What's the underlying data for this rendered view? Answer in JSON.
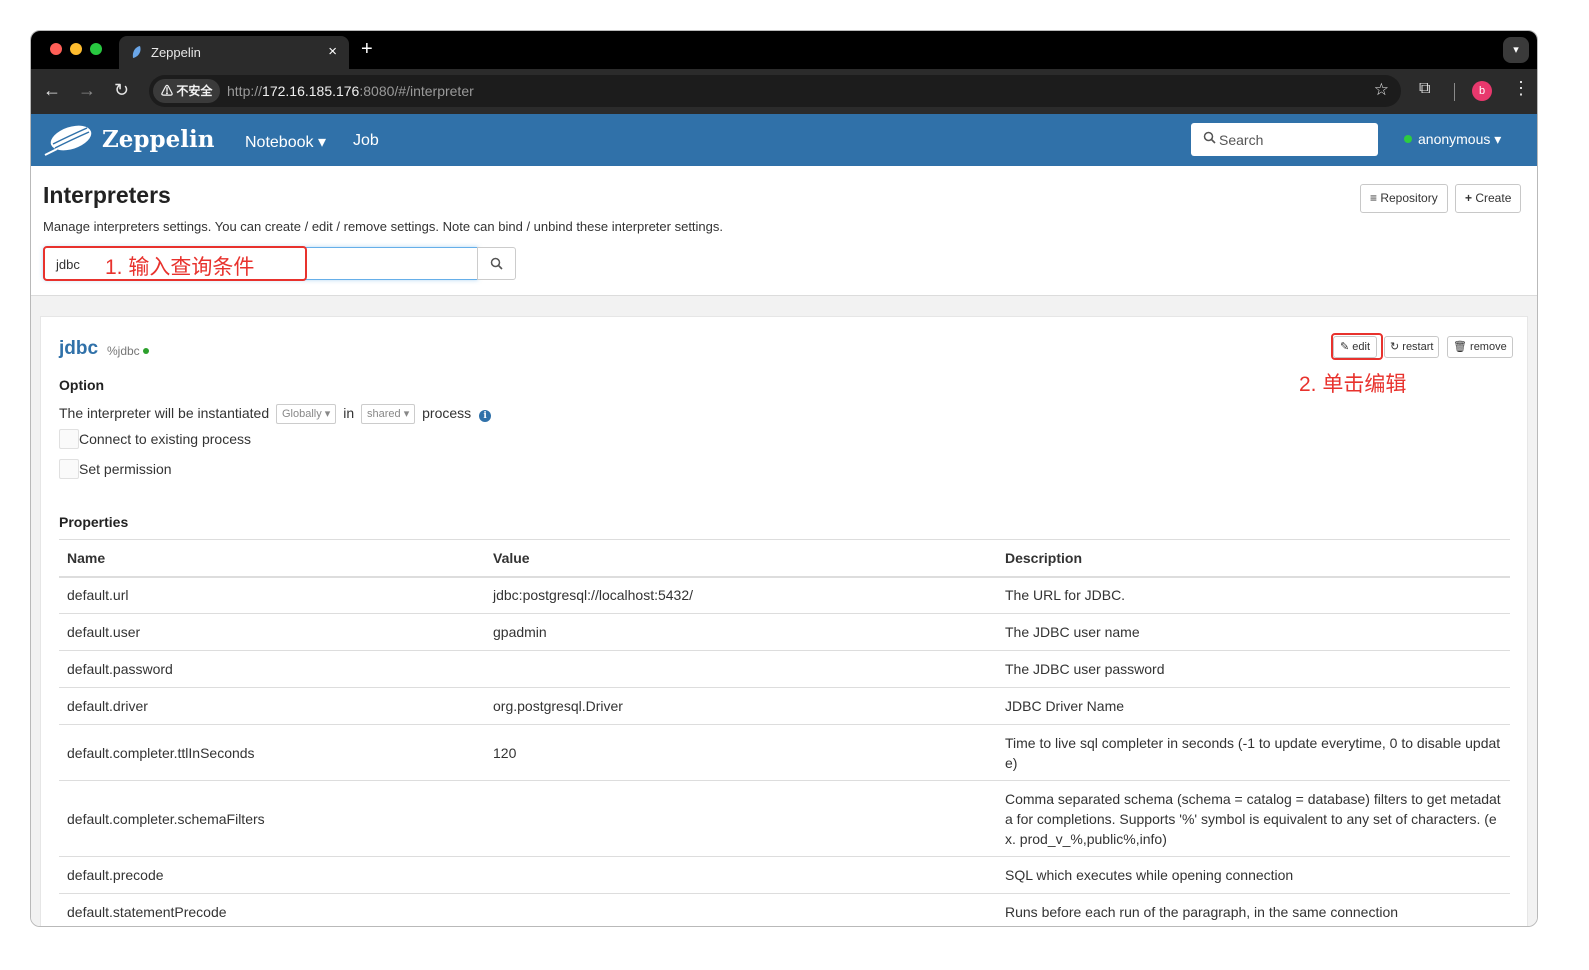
{
  "browser": {
    "tab_title": "Zeppelin",
    "tab_close": "×",
    "new_tab": "+",
    "security_label": "⚠ 不安全",
    "url_scheme": "http://",
    "url_host": "172.16.185.176",
    "url_rest": ":8080/#/interpreter",
    "profile_initial": "b"
  },
  "navbar": {
    "brand": "Zeppelin",
    "notebook_label": "Notebook ▾",
    "job_label": "Job",
    "search_placeholder": "Search",
    "user_label": "anonymous ▾"
  },
  "header": {
    "title": "Interpreters",
    "description": "Manage interpreters settings. You can create / edit / remove settings. Note can bind / unbind these interpreter settings.",
    "repository_label": "Repository",
    "create_label": "Create",
    "filter_value": "jdbc"
  },
  "annotations": {
    "step1": "1. 输入查询条件",
    "step2": "2. 单击编辑"
  },
  "interpreter": {
    "name": "jdbc",
    "alias": "%jdbc",
    "status_color": "#2ca02c",
    "edit_label": "edit",
    "restart_label": "restart",
    "remove_label": "remove",
    "option_title": "Option",
    "option_prefix": "The interpreter will be instantiated",
    "option_scope": "Globally ▾",
    "option_in": "in",
    "option_mode": "shared ▾",
    "option_suffix": "process",
    "connect_existing_label": "Connect to existing process",
    "set_permission_label": "Set permission",
    "properties_title": "Properties",
    "columns": [
      "Name",
      "Value",
      "Description"
    ],
    "properties": [
      {
        "name": "default.url",
        "value": "jdbc:postgresql://localhost:5432/",
        "description": "The URL for JDBC."
      },
      {
        "name": "default.user",
        "value": "gpadmin",
        "description": "The JDBC user name"
      },
      {
        "name": "default.password",
        "value": "",
        "description": "The JDBC user password"
      },
      {
        "name": "default.driver",
        "value": "org.postgresql.Driver",
        "description": "JDBC Driver Name"
      },
      {
        "name": "default.completer.ttlInSeconds",
        "value": "120",
        "description": "Time to live sql completer in seconds (-1 to update everytime, 0 to disable updat e)"
      },
      {
        "name": "default.completer.schemaFilters",
        "value": "",
        "description": "Comma separated schema (schema = catalog = database) filters to get metadat a for completions. Supports '%' symbol is equivalent to any set of characters. (e x. prod_v_%,public%,info)"
      },
      {
        "name": "default.precode",
        "value": "",
        "description": "SQL which executes while opening connection"
      },
      {
        "name": "default.statementPrecode",
        "value": "",
        "description": "Runs before each run of the paragraph, in the same connection"
      }
    ]
  },
  "colors": {
    "navbar_bg": "#3071a9",
    "annotation_red": "#e8322d",
    "link_blue": "#3071a9"
  }
}
